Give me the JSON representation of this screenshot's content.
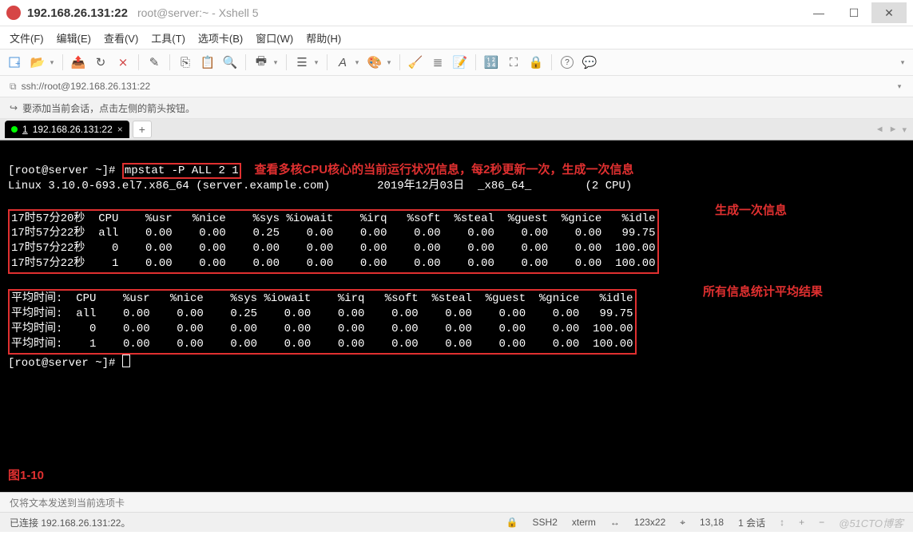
{
  "title": {
    "ip": "192.168.26.131:22",
    "sub": "root@server:~ - Xshell 5"
  },
  "menu": {
    "file": "文件(F)",
    "edit": "编辑(E)",
    "view": "查看(V)",
    "tools": "工具(T)",
    "tabs": "选项卡(B)",
    "window": "窗口(W)",
    "help": "帮助(H)"
  },
  "address": {
    "scheme_icon": "⎘",
    "url": "ssh://root@192.168.26.131:22"
  },
  "infobar": {
    "icon": "▸",
    "text": "要添加当前会话，点击左侧的箭头按钮。"
  },
  "tab": {
    "index": "1",
    "label": "192.168.26.131:22"
  },
  "term": {
    "prompt1": "[root@server ~]# ",
    "command": "mpstat -P ALL 2 1",
    "annot_command": "查看多核CPU核心的当前运行状况信息，每2秒更新一次，生成一次信息",
    "sysline": "Linux 3.10.0-693.el7.x86_64 (server.example.com)       2019年12月03日  _x86_64_        (2 CPU)",
    "header1": "17时57分20秒  CPU    %usr   %nice    %sys %iowait    %irq   %soft  %steal  %guest  %gnice   %idle",
    "row1": "17时57分22秒  all    0.00    0.00    0.25    0.00    0.00    0.00    0.00    0.00    0.00   99.75",
    "row2": "17时57分22秒    0    0.00    0.00    0.00    0.00    0.00    0.00    0.00    0.00    0.00  100.00",
    "row3": "17时57分22秒    1    0.00    0.00    0.00    0.00    0.00    0.00    0.00    0.00    0.00  100.00",
    "annot_block1": "生成一次信息",
    "header2": "平均时间:  CPU    %usr   %nice    %sys %iowait    %irq   %soft  %steal  %guest  %gnice   %idle",
    "arow1": "平均时间:  all    0.00    0.00    0.25    0.00    0.00    0.00    0.00    0.00    0.00   99.75",
    "arow2": "平均时间:    0    0.00    0.00    0.00    0.00    0.00    0.00    0.00    0.00    0.00  100.00",
    "arow3": "平均时间:    1    0.00    0.00    0.00    0.00    0.00    0.00    0.00    0.00    0.00  100.00",
    "annot_block2": "所有信息统计平均结果",
    "prompt2": "[root@server ~]# ",
    "figure": "图1-10"
  },
  "status1": "仅将文本发送到当前选项卡",
  "status2": {
    "conn": "已连接 192.168.26.131:22。",
    "proto": "SSH2",
    "term": "xterm",
    "size": "123x22",
    "cursor": "13,18",
    "sessions": "1 会话",
    "watermark": "@51CTO博客"
  },
  "icons": {
    "lock": "🔒",
    "ssh": "⧉",
    "chev": "▾",
    "help": "?",
    "bubble": "💬",
    "newfile": "📄",
    "open": "📂",
    "send": "📤",
    "brush": "✎",
    "copy": "⎘",
    "paste": "📋",
    "search": "🔍",
    "print": "🖶",
    "props": "☰",
    "font": "A",
    "color": "🎨",
    "cls": "🧹",
    "scroll": "≣",
    "rec": "●",
    "pad": "🔢",
    "full": "⛶",
    "lockscr": "🔒",
    "new": "+"
  }
}
